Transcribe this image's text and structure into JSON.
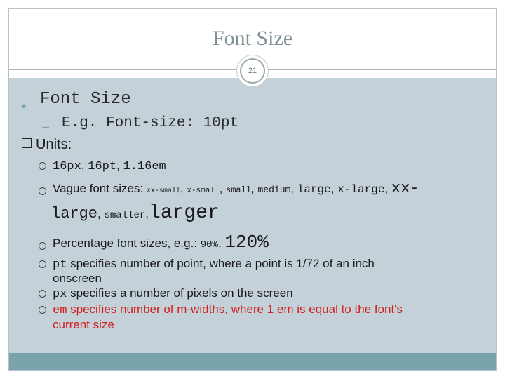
{
  "slide": {
    "title": "Font Size",
    "slide_number": "21",
    "level1": "Font Size",
    "level2_prefix": "–",
    "level2": "E.g. Font-size: 10pt",
    "units_label": "Units:"
  },
  "bullets": {
    "b1": {
      "t1": "16px",
      "t2": ", ",
      "t3": "16pt",
      "t4": ", ",
      "t5": "1.16em"
    },
    "b2": {
      "lead": "Vague font sizes: ",
      "xx_small": "xx-small",
      "sep1": ", ",
      "x_small": "x-small",
      "sep2": ", ",
      "small": "small",
      "sep3": ", ",
      "medium": "medium",
      "sep4": ", ",
      "large": "large",
      "sep5": ", ",
      "x_large": "x-large",
      "sep6": ", ",
      "xx_large_a": "xx-",
      "xx_large_b": "large",
      "sep7": ", ",
      "smaller": "smaller",
      "sep8": ",",
      "larger": "larger"
    },
    "b3": {
      "lead": "Percentage font sizes, e.g.: ",
      "p90": "90%",
      "sep": ", ",
      "p120": "120%"
    },
    "b4": {
      "code": "pt",
      "line1": " specifies number of point, where a point is 1/72 of an inch",
      "line2": "onscreen"
    },
    "b5": {
      "code": "px",
      "text": " specifies a number of pixels on the screen"
    },
    "b6": {
      "code": "em",
      "line1": " specifies number of m-widths, where 1 em is equal to the font's",
      "line2": "current size"
    }
  },
  "colors": {
    "title": "#7f9398",
    "panel": "#c5d1d8",
    "footer": "#79a3ad",
    "emphasis": "#d11f1f"
  }
}
